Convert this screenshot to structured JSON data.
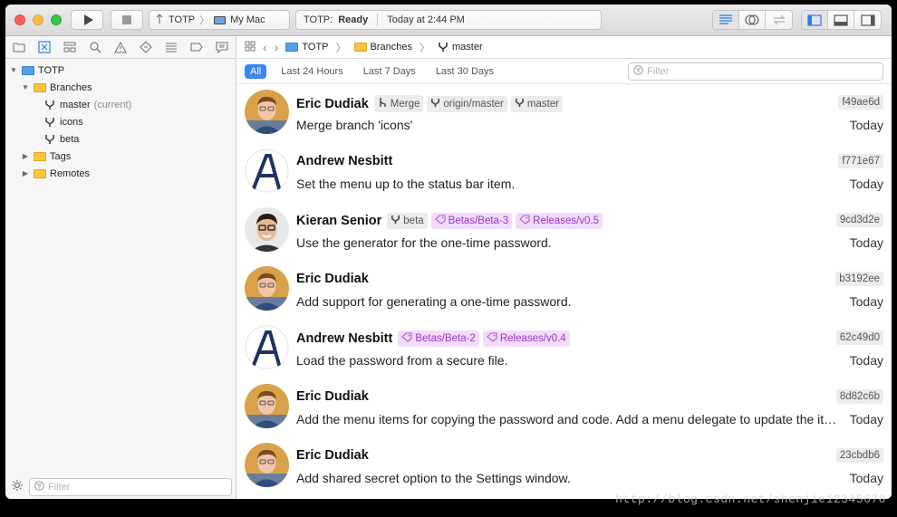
{
  "toolbar": {
    "scheme_target": "TOTP",
    "scheme_device": "My Mac",
    "status_app": "TOTP:",
    "status_state": "Ready",
    "status_time": "Today at 2:44 PM"
  },
  "sidebar": {
    "repo": "TOTP",
    "branches_label": "Branches",
    "branches": [
      {
        "name": "master",
        "note": "(current)"
      },
      {
        "name": "icons",
        "note": ""
      },
      {
        "name": "beta",
        "note": ""
      }
    ],
    "tags_label": "Tags",
    "remotes_label": "Remotes",
    "filter_placeholder": "Filter"
  },
  "jumpbar": {
    "repo": "TOTP",
    "group": "Branches",
    "branch": "master"
  },
  "filters": {
    "tabs": [
      "All",
      "Last 24 Hours",
      "Last 7 Days",
      "Last 30 Days"
    ],
    "placeholder": "Filter"
  },
  "commits": [
    {
      "author": "Eric Dudiak",
      "avatar": "eric",
      "tags": [
        {
          "kind": "merge",
          "label": "Merge"
        },
        {
          "kind": "branch",
          "label": "origin/master"
        },
        {
          "kind": "branch",
          "label": "master"
        }
      ],
      "message": "Merge branch 'icons'",
      "sha": "f49ae6d",
      "date": "Today"
    },
    {
      "author": "Andrew Nesbitt",
      "avatar": "andrew",
      "tags": [],
      "message": "Set the menu up to the status bar item.",
      "sha": "f771e67",
      "date": "Today"
    },
    {
      "author": "Kieran Senior",
      "avatar": "kieran",
      "tags": [
        {
          "kind": "branch",
          "label": "beta"
        },
        {
          "kind": "tag",
          "label": "Betas/Beta-3"
        },
        {
          "kind": "tag",
          "label": "Releases/v0.5"
        }
      ],
      "message": "Use the generator for the one-time password.",
      "sha": "9cd3d2e",
      "date": "Today"
    },
    {
      "author": "Eric Dudiak",
      "avatar": "eric",
      "tags": [],
      "message": "Add support for generating a one-time password.",
      "sha": "b3192ee",
      "date": "Today"
    },
    {
      "author": "Andrew Nesbitt",
      "avatar": "andrew",
      "tags": [
        {
          "kind": "tag",
          "label": "Betas/Beta-2"
        },
        {
          "kind": "tag",
          "label": "Releases/v0.4"
        }
      ],
      "message": "Load the password from a secure file.",
      "sha": "62c49d0",
      "date": "Today"
    },
    {
      "author": "Eric Dudiak",
      "avatar": "eric",
      "tags": [],
      "message": "Add the menu items for copying the password and code. Add a menu delegate to update the items.",
      "sha": "8d82c6b",
      "date": "Today"
    },
    {
      "author": "Eric Dudiak",
      "avatar": "eric",
      "tags": [],
      "message": "Add shared secret option to the Settings window.",
      "sha": "23cbdb6",
      "date": "Today"
    }
  ],
  "watermark": "http://blog.csdn.net/shenjie12345678",
  "colors": {
    "accent": "#3c86ef",
    "tag_purple_bg": "#f2dcfa",
    "tag_purple_fg": "#9b35c7",
    "folder_yellow": "#f6c63b",
    "folder_blue": "#56a0e8"
  }
}
